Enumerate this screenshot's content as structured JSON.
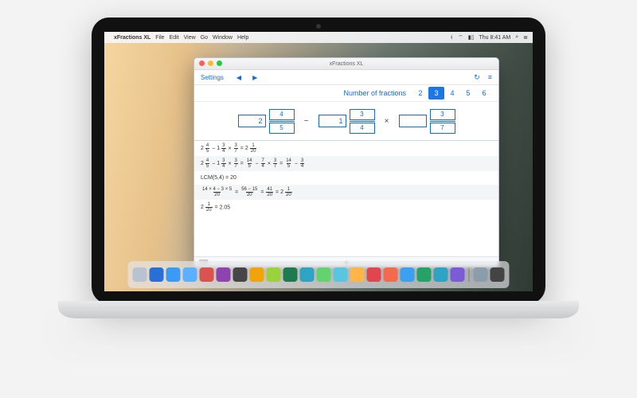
{
  "os_menubar": {
    "app_name": "xFractions XL",
    "items": [
      "File",
      "Edit",
      "View",
      "Go",
      "Window",
      "Help"
    ],
    "right": {
      "clock": "Thu 8:41 AM"
    }
  },
  "window": {
    "title": "xFractions XL",
    "toolbar": {
      "settings_label": "Settings",
      "nav_prev": "◀",
      "nav_next": "▶",
      "refresh": "↻",
      "menu": "≡"
    },
    "fraction_count": {
      "label": "Number of fractions",
      "options": [
        "2",
        "3",
        "4",
        "5",
        "6"
      ],
      "selected": "3"
    },
    "expression": {
      "terms": [
        {
          "whole": "2",
          "num": "4",
          "den": "5"
        },
        {
          "whole": "1",
          "num": "3",
          "den": "4"
        },
        {
          "whole": "",
          "num": "3",
          "den": "7"
        }
      ],
      "operators": [
        "−",
        "×"
      ]
    },
    "work_steps": {
      "line1": {
        "pre": "",
        "a": {
          "w": "2",
          "n": "4",
          "d": "5"
        },
        "op1": " − ",
        "b": {
          "w": "1",
          "n": "3",
          "d": "4"
        },
        "op2": " × ",
        "c": {
          "n": "3",
          "d": "7"
        },
        "eq": " = ",
        "r": {
          "w": "2",
          "n": "1",
          "d": "20"
        }
      },
      "line2": {
        "a": {
          "w": "2",
          "n": "4",
          "d": "5"
        },
        "t1": " − ",
        "b": {
          "w": "1",
          "n": "3",
          "d": "4"
        },
        "t2": " × ",
        "c": {
          "n": "3",
          "d": "7"
        },
        "t3": " = ",
        "d": {
          "n": "14",
          "d": "5"
        },
        "t4": " − ",
        "e": {
          "n": "7",
          "d": "4"
        },
        "t5": " × ",
        "f": {
          "n": "3",
          "d": "7"
        },
        "t6": " = ",
        "g": {
          "n": "14",
          "d": "5"
        },
        "t7": " − ",
        "h": {
          "n": "3",
          "d": "4"
        }
      },
      "line3_text": "LCM(5,4) = 20",
      "line4": {
        "a": {
          "n": "14 × 4 − 3 × 5",
          "d": "20"
        },
        "t1": " = ",
        "b": {
          "n": "56 − 15",
          "d": "20"
        },
        "t2": " = ",
        "c": {
          "n": "41",
          "d": "20"
        },
        "t3": " = ",
        "d": {
          "w": "2",
          "n": "1",
          "d": "20"
        }
      },
      "line5": {
        "a": {
          "w": "2",
          "n": "1",
          "d": "20"
        },
        "t": " = 2.05"
      }
    },
    "statusbar": {
      "handle": "▲",
      "corner": "⌨"
    }
  },
  "dock_colors": [
    "#b7c3d0",
    "#2a6fd6",
    "#3a9bf4",
    "#5bb0ff",
    "#d9534f",
    "#8e44ad",
    "#464646",
    "#f0a30a",
    "#9ad13c",
    "#1f7a4d",
    "#2fa3c4",
    "#63d26f",
    "#58c6e0",
    "#ffb547",
    "#e0474c",
    "#f26b4e",
    "#3aa0ef",
    "#26a269",
    "#2fa3c4",
    "#7b5bd6",
    "#8b9cab",
    "#444"
  ]
}
